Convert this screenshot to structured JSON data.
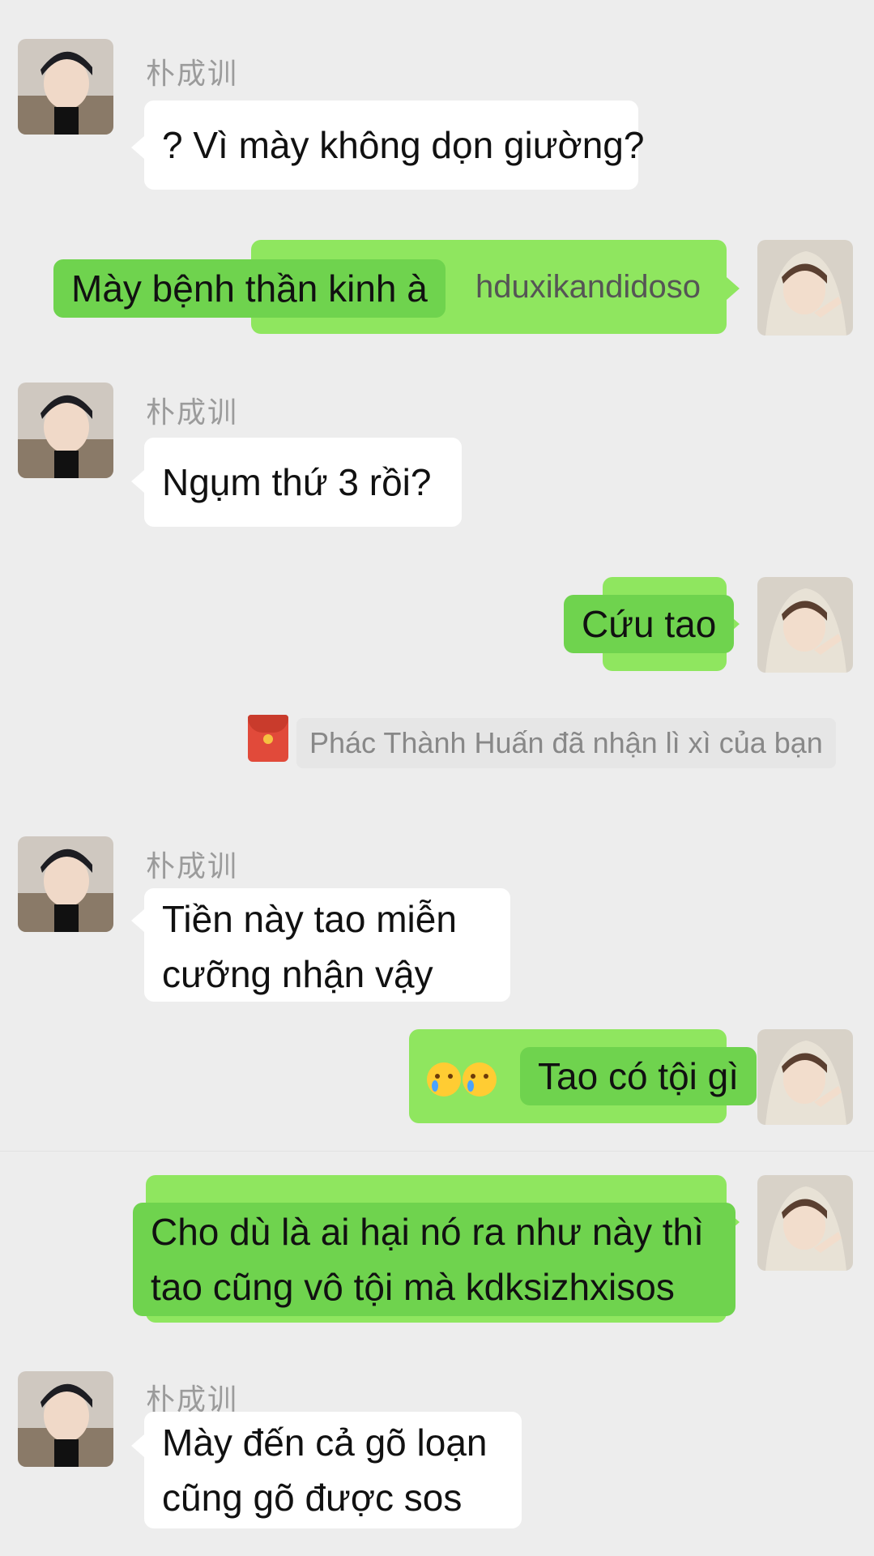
{
  "sender_name": "朴成训",
  "messages": [
    {
      "id": "m1",
      "side": "in",
      "text": "? Vì mày không dọn giường?"
    },
    {
      "id": "m2",
      "side": "out",
      "text": "Mày bệnh thần kinh à",
      "trail": "hduxikandidoso"
    },
    {
      "id": "m3",
      "side": "in",
      "text": "Ngụm thứ 3 rồi?"
    },
    {
      "id": "m4",
      "side": "out",
      "text": "Cứu tao"
    },
    {
      "id": "m5",
      "side": "out",
      "text": "Tao có tội gì",
      "emojis": [
        "crying-face",
        "loudly-crying-face"
      ]
    },
    {
      "id": "m6",
      "side": "out",
      "lines": [
        "Cho dù là ai hại nó ra như này thì",
        "tao cũng vô tội mà kdksizhxisos"
      ]
    },
    {
      "id": "m7",
      "side": "in",
      "lines": [
        "Tiền này tao miễn",
        "cưỡng nhận vậy"
      ]
    },
    {
      "id": "m8",
      "side": "in",
      "lines": [
        "Mày đến cả gõ loạn",
        "cũng gõ được sos"
      ]
    }
  ],
  "system": {
    "red_packet_notice": "Phác Thành Huấn đã nhận lì xì của bạn",
    "icon": "red-envelope-icon"
  },
  "colors": {
    "background": "#ededed",
    "outgoing_bubble": "#8fe65f",
    "incoming_bubble": "#ffffff",
    "highlight": "#6fd34e"
  }
}
